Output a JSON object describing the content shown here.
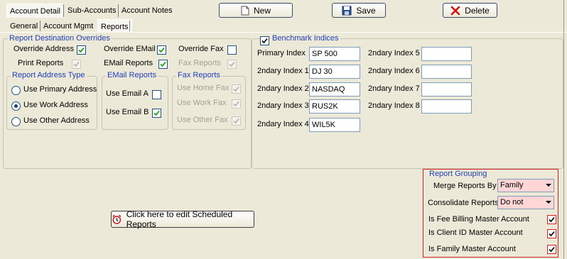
{
  "top_tabs": [
    "Account Detail",
    "Sub-Accounts",
    "Account Notes"
  ],
  "toolbar": {
    "new_label": "New",
    "save_label": "Save",
    "delete_label": "Delete"
  },
  "sub_tabs": [
    "General",
    "Account Mgmt",
    "Reports"
  ],
  "overrides": {
    "legend": "Report Destination Overrides",
    "override_address": "Override Address",
    "override_email": "Override EMail",
    "override_fax": "Override Fax",
    "print_reports": "Print Reports",
    "email_reports": "EMail Reports",
    "fax_reports": "Fax Reports",
    "address_type": {
      "legend": "Report Address Type",
      "options": [
        "Use Primary Address",
        "Use Work Address",
        "Use Other Address"
      ],
      "selected": "Use Work Address"
    },
    "email_group": {
      "legend": "EMail Reports",
      "email_a": "Use Email A",
      "email_b": "Use Email B"
    },
    "fax_group": {
      "legend": "Fax Reports",
      "home": "Use Home Fax",
      "work": "Use Work Fax",
      "other": "Use Other Fax"
    }
  },
  "benchmark": {
    "legend": "Benchmark Indices",
    "rows": [
      {
        "label": "Primary Index",
        "value": "SP 500"
      },
      {
        "label": "2ndary Index 1",
        "value": "DJ 30"
      },
      {
        "label": "2ndary Index 2",
        "value": "NASDAQ"
      },
      {
        "label": "2ndary Index 3",
        "value": "RUS2K"
      },
      {
        "label": "2ndary Index 4",
        "value": "WIL5K"
      },
      {
        "label": "2ndary Index 5",
        "value": ""
      },
      {
        "label": "2ndary Index 6",
        "value": ""
      },
      {
        "label": "2ndary Index 7",
        "value": ""
      },
      {
        "label": "2ndary Index 8",
        "value": ""
      }
    ]
  },
  "scheduled_button": "Click here to edit Scheduled Reports",
  "grouping": {
    "legend": "Report Grouping",
    "merge_label": "Merge Reports By",
    "merge_value": "Family",
    "consolidate_label": "Consolidate Reports",
    "consolidate_value": "Do not",
    "fee_master": "Is Fee Billing Master Account",
    "client_master": "Is Client ID Master Account",
    "family_master": "Is Family Master Account"
  }
}
